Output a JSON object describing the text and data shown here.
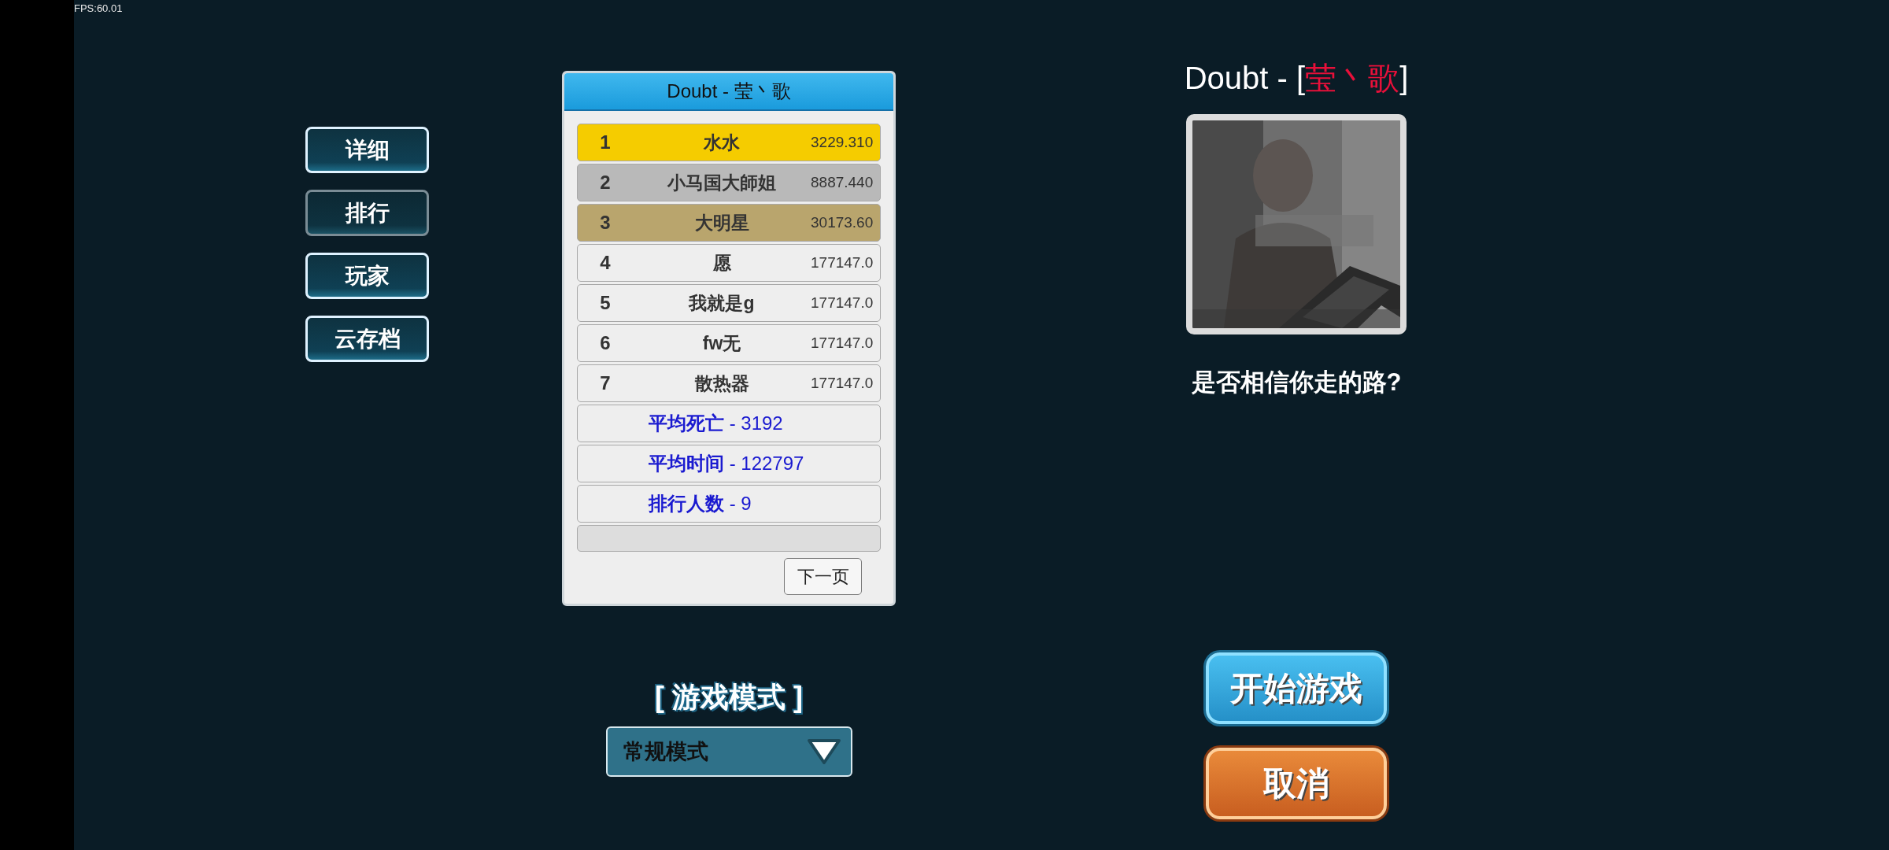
{
  "fps": "FPS:60.01",
  "side_tabs": [
    {
      "label": "详细",
      "selected": false
    },
    {
      "label": "排行",
      "selected": true
    },
    {
      "label": "玩家",
      "selected": false
    },
    {
      "label": "云存档",
      "selected": false
    }
  ],
  "leaderboard": {
    "title": "Doubt - 莹丶歌",
    "rows": [
      {
        "rank": "1",
        "name": "水水",
        "score": "3229.310",
        "color": "#f5cc00"
      },
      {
        "rank": "2",
        "name": "小马国大師姐",
        "score": "8887.440",
        "color": "#b9b9b9"
      },
      {
        "rank": "3",
        "name": "大明星",
        "score": "30173.60",
        "color": "#b9a56d"
      },
      {
        "rank": "4",
        "name": "愿",
        "score": "177147.0",
        "color": "#eeeeee"
      },
      {
        "rank": "5",
        "name": "我就是g",
        "score": "177147.0",
        "color": "#eeeeee"
      },
      {
        "rank": "6",
        "name": "fw无",
        "score": "177147.0",
        "color": "#eeeeee"
      },
      {
        "rank": "7",
        "name": "散热器",
        "score": "177147.0",
        "color": "#eeeeee"
      }
    ],
    "stats": [
      "**平均死亡** - 3192",
      "**平均时间** - 122797",
      "**排行人数** - 9"
    ],
    "next_button": "下一页"
  },
  "mode": {
    "label": "[ 游戏模式 ]",
    "value": "常规模式"
  },
  "song": {
    "title_prefix": "Doubt - [",
    "artist": "莹丶歌",
    "title_suffix": "]",
    "subtitle": "是否相信你走的路?"
  },
  "buttons": {
    "start": "开始游戏",
    "cancel": "取消"
  }
}
